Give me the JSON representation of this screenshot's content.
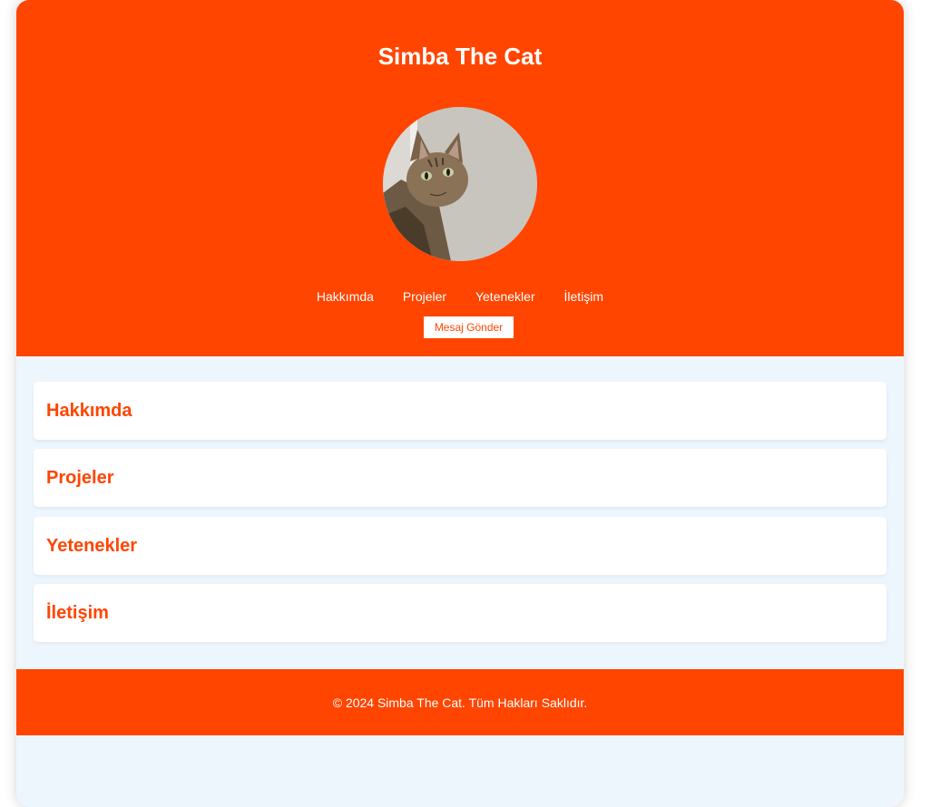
{
  "header": {
    "title": "Simba The Cat",
    "avatar_alt": "cat-photo",
    "nav": [
      "Hakkımda",
      "Projeler",
      "Yetenekler",
      "İletişim"
    ],
    "cta_label": "Mesaj Gönder"
  },
  "sections": [
    {
      "title": "Hakkımda"
    },
    {
      "title": "Projeler"
    },
    {
      "title": "Yetenekler"
    },
    {
      "title": "İletişim"
    }
  ],
  "footer": {
    "text": "© 2024 Simba The Cat. Tüm Hakları Saklıdır."
  },
  "colors": {
    "accent": "#ff4500",
    "page_bg": "#eef6fd",
    "card_bg": "#ffffff"
  }
}
